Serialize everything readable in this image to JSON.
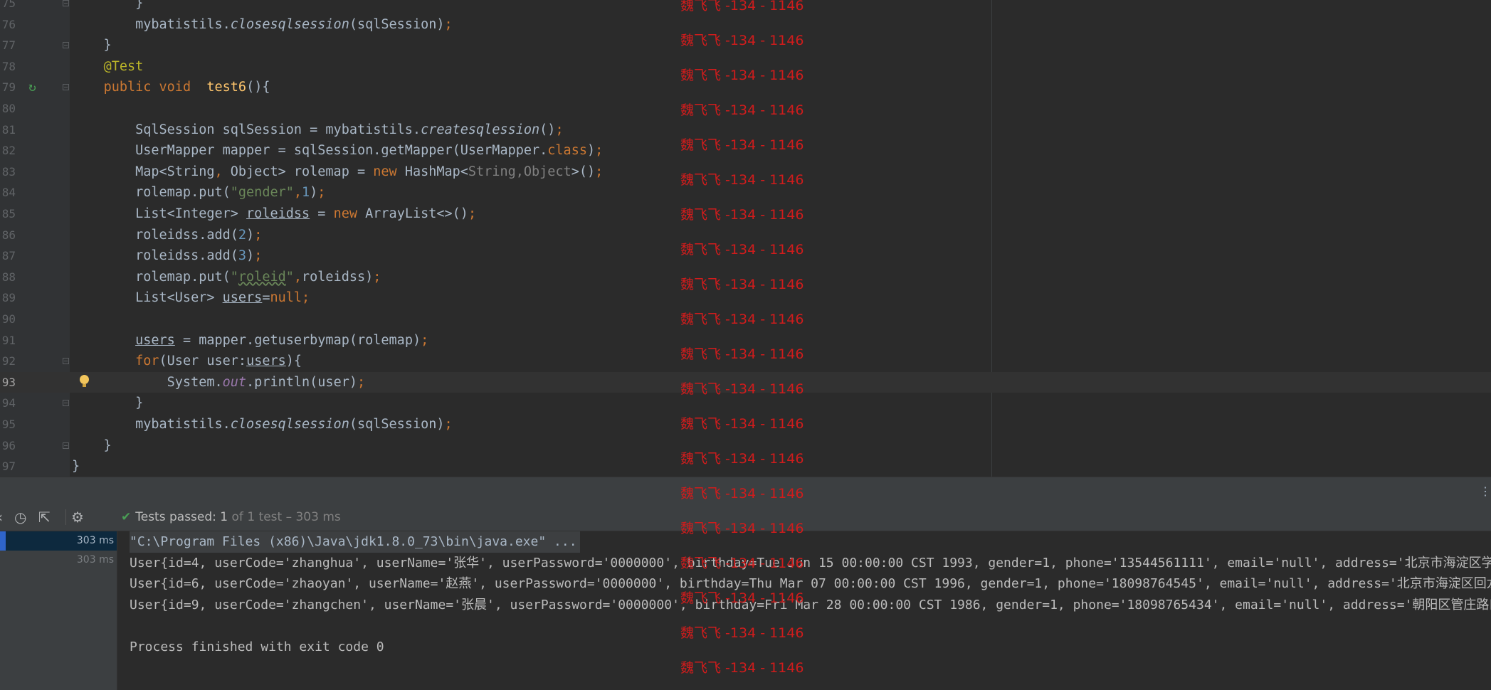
{
  "editor": {
    "current_line": "93",
    "run_gutter_line": "79",
    "bulb_line": "93",
    "fold_lines": [
      "75",
      "77",
      "79",
      "92",
      "94",
      "96"
    ],
    "lines": [
      {
        "n": "75",
        "tokens": [
          {
            "t": "        }"
          }
        ]
      },
      {
        "n": "76",
        "tokens": [
          {
            "t": "        mybatistils."
          },
          {
            "t": "closesqlsession",
            "c": "it"
          },
          {
            "t": "(sqlSession)"
          },
          {
            "t": ";",
            "c": "kw"
          }
        ]
      },
      {
        "n": "77",
        "tokens": [
          {
            "t": "    }"
          }
        ]
      },
      {
        "n": "78",
        "tokens": [
          {
            "t": "    "
          },
          {
            "t": "@Test",
            "c": "an"
          }
        ]
      },
      {
        "n": "79",
        "tokens": [
          {
            "t": "    "
          },
          {
            "t": "public void  ",
            "c": "kw"
          },
          {
            "t": "test6",
            "c": "fn"
          },
          {
            "t": "(){"
          }
        ]
      },
      {
        "n": "80",
        "tokens": [
          {
            "t": ""
          }
        ]
      },
      {
        "n": "81",
        "tokens": [
          {
            "t": "        SqlSession sqlSession = mybatistils."
          },
          {
            "t": "createsqlession",
            "c": "it"
          },
          {
            "t": "()"
          },
          {
            "t": ";",
            "c": "kw"
          }
        ]
      },
      {
        "n": "82",
        "tokens": [
          {
            "t": "        UserMapper mapper = sqlSession.getMapper(UserMapper."
          },
          {
            "t": "class",
            "c": "kw"
          },
          {
            "t": ")"
          },
          {
            "t": ";",
            "c": "kw"
          }
        ]
      },
      {
        "n": "83",
        "tokens": [
          {
            "t": "        Map<String"
          },
          {
            "t": ", ",
            "c": "kw"
          },
          {
            "t": "Object> rolemap = "
          },
          {
            "t": "new ",
            "c": "kw"
          },
          {
            "t": "HashMap<"
          },
          {
            "t": "String,Object",
            "c": "gen"
          },
          {
            "t": ">()"
          },
          {
            "t": ";",
            "c": "kw"
          }
        ]
      },
      {
        "n": "84",
        "tokens": [
          {
            "t": "        rolemap.put("
          },
          {
            "t": "\"gender\"",
            "c": "str"
          },
          {
            "t": ",",
            "c": "kw"
          },
          {
            "t": "1",
            "c": "num"
          },
          {
            "t": ")"
          },
          {
            "t": ";",
            "c": "kw"
          }
        ]
      },
      {
        "n": "85",
        "tokens": [
          {
            "t": "        List<Integer> "
          },
          {
            "t": "roleidss",
            "c": "ul"
          },
          {
            "t": " = "
          },
          {
            "t": "new ",
            "c": "kw"
          },
          {
            "t": "ArrayList<>()"
          },
          {
            "t": ";",
            "c": "kw"
          }
        ]
      },
      {
        "n": "86",
        "tokens": [
          {
            "t": "        roleidss.add("
          },
          {
            "t": "2",
            "c": "num"
          },
          {
            "t": ")"
          },
          {
            "t": ";",
            "c": "kw"
          }
        ]
      },
      {
        "n": "87",
        "tokens": [
          {
            "t": "        roleidss.add("
          },
          {
            "t": "3",
            "c": "num"
          },
          {
            "t": ")"
          },
          {
            "t": ";",
            "c": "kw"
          }
        ]
      },
      {
        "n": "88",
        "tokens": [
          {
            "t": "        rolemap.put("
          },
          {
            "t": "\"",
            "c": "str"
          },
          {
            "t": "roleid",
            "c": "str wavy"
          },
          {
            "t": "\"",
            "c": "str"
          },
          {
            "t": ",",
            "c": "kw"
          },
          {
            "t": "roleidss)"
          },
          {
            "t": ";",
            "c": "kw"
          }
        ]
      },
      {
        "n": "89",
        "tokens": [
          {
            "t": "        List<User> "
          },
          {
            "t": "users",
            "c": "ul"
          },
          {
            "t": "="
          },
          {
            "t": "null",
            "c": "kw"
          },
          {
            "t": ";",
            "c": "kw"
          }
        ]
      },
      {
        "n": "90",
        "tokens": [
          {
            "t": ""
          }
        ]
      },
      {
        "n": "91",
        "tokens": [
          {
            "t": "        "
          },
          {
            "t": "users",
            "c": "ul"
          },
          {
            "t": " = mapper.getuserbymap(rolemap)"
          },
          {
            "t": ";",
            "c": "kw"
          }
        ]
      },
      {
        "n": "92",
        "tokens": [
          {
            "t": "        "
          },
          {
            "t": "for",
            "c": "kw"
          },
          {
            "t": "(User user:"
          },
          {
            "t": "users",
            "c": "ul"
          },
          {
            "t": "){"
          }
        ]
      },
      {
        "n": "93",
        "tokens": [
          {
            "t": "            System."
          },
          {
            "t": "out",
            "c": "fld"
          },
          {
            "t": ".println(user)"
          },
          {
            "t": ";",
            "c": "kw"
          }
        ]
      },
      {
        "n": "94",
        "tokens": [
          {
            "t": "        }"
          }
        ]
      },
      {
        "n": "95",
        "tokens": [
          {
            "t": "        mybatistils."
          },
          {
            "t": "closesqlsession",
            "c": "it"
          },
          {
            "t": "(sqlSession)"
          },
          {
            "t": ";",
            "c": "kw"
          }
        ]
      },
      {
        "n": "96",
        "tokens": [
          {
            "t": "    }"
          }
        ]
      },
      {
        "n": "97",
        "tokens": [
          {
            "t": "}"
          }
        ]
      }
    ]
  },
  "toolbar": {
    "status_check_icon": "check-icon",
    "status_prefix": "Tests passed:",
    "status_count": " 1",
    "status_suffix": " of 1 test – 303 ms"
  },
  "test_tree": {
    "items": [
      {
        "time": "303 ms",
        "selected": true
      },
      {
        "time": "303 ms",
        "selected": false
      }
    ]
  },
  "console": {
    "lines": [
      "\"C:\\Program Files (x86)\\Java\\jdk1.8.0_73\\bin\\java.exe\" ...",
      "User{id=4, userCode='zhanghua', userName='张华', userPassword='0000000', birthday=Tue Jun 15 00:00:00 CST 1993, gender=1, phone='13544561111', email='null', address='北京市海淀区学院",
      "User{id=6, userCode='zhaoyan', userName='赵燕', userPassword='0000000', birthday=Thu Mar 07 00:00:00 CST 1996, gender=1, phone='18098764545', email='null', address='北京市海淀区回龙观",
      "User{id=9, userCode='zhangchen', userName='张晨', userPassword='0000000', birthday=Fri Mar 28 00:00:00 CST 1986, gender=1, phone='18098765434', email='null', address='朝阳区管庄路口北",
      "",
      "Process finished with exit code 0"
    ]
  },
  "watermark": {
    "text": "魏飞飞 -134 - 1146",
    "count": 20
  }
}
